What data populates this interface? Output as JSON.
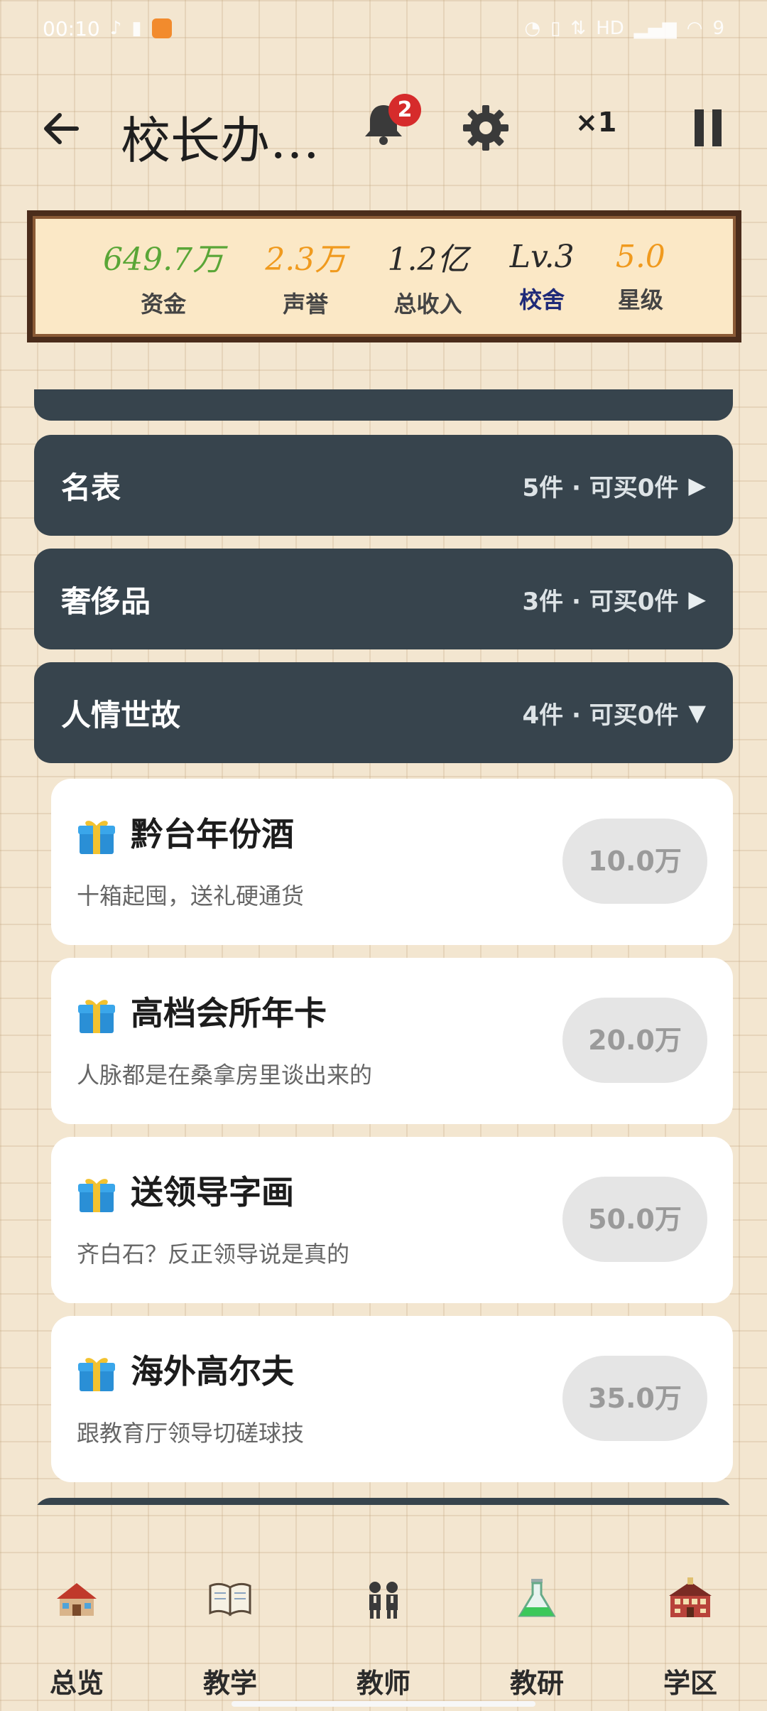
{
  "status_bar": {
    "time": "00:10",
    "battery": "9"
  },
  "header": {
    "title": "校长办…",
    "notification_count": "2",
    "speed_label": "×1"
  },
  "stats": [
    {
      "value": "649.7万",
      "label": "资金",
      "value_color": "#5aa637",
      "label_color": "#444444"
    },
    {
      "value": "2.3万",
      "label": "声誉",
      "value_color": "#f09a1e",
      "label_color": "#444444"
    },
    {
      "value": "1.2亿",
      "label": "总收入",
      "value_color": "#2a2a2a",
      "label_color": "#444444"
    },
    {
      "value": "Lv.3",
      "label": "校舍",
      "value_color": "#2a2a2a",
      "label_color": "#1f2a78"
    },
    {
      "value": "5.0",
      "label": "星级",
      "value_color": "#f09a1e",
      "label_color": "#444444"
    }
  ],
  "categories": [
    {
      "name": "名表",
      "meta": "5件 · 可买0件",
      "arrow": "▶"
    },
    {
      "name": "奢侈品",
      "meta": "3件 · 可买0件",
      "arrow": "▶"
    },
    {
      "name": "人情世故",
      "meta": "4件 · 可买0件",
      "arrow": "▼"
    }
  ],
  "items": [
    {
      "name": "黔台年份酒",
      "desc": "十箱起囤，送礼硬通货",
      "price": "10.0万"
    },
    {
      "name": "高档会所年卡",
      "desc": "人脉都是在桑拿房里谈出来的",
      "price": "20.0万"
    },
    {
      "name": "送领导字画",
      "desc": "齐白石？反正领导说是真的",
      "price": "50.0万"
    },
    {
      "name": "海外高尔夫",
      "desc": "跟教育厅领导切磋球技",
      "price": "35.0万"
    }
  ],
  "nav": [
    {
      "label": "总览",
      "icon": "school-house-icon"
    },
    {
      "label": "教学",
      "icon": "open-book-icon"
    },
    {
      "label": "教师",
      "icon": "teachers-icon"
    },
    {
      "label": "教研",
      "icon": "flask-icon"
    },
    {
      "label": "学区",
      "icon": "school-building-icon"
    }
  ]
}
